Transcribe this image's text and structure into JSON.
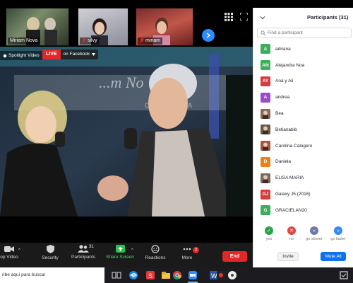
{
  "meeting": {
    "thumbnails": [
      {
        "label": "Miriam Nova",
        "muted": false
      },
      {
        "label": "silvy",
        "muted": true
      },
      {
        "label": "miriam",
        "muted": true
      }
    ],
    "spotlight_label": "Spotlight Video",
    "live": {
      "badge": "LIVE",
      "destination": "on Facebook"
    }
  },
  "toolbar": {
    "stop_video": "op Video",
    "security": "Security",
    "participants": "Participants",
    "participants_count": "31",
    "share_screen": "Share Screen",
    "reactions": "Reactions",
    "more": "More",
    "more_badge": "2",
    "end": "End"
  },
  "panel": {
    "title": "Participants (31)",
    "search_placeholder": "Find a participant",
    "participants": [
      {
        "initials": "A",
        "name": "adriana",
        "color": "#3eae5a",
        "photo": false
      },
      {
        "initials": "AN",
        "name": "Alejandra Noa",
        "color": "#3eae5a",
        "photo": false
      },
      {
        "initials": "AY",
        "name": "Ana y Ali",
        "color": "#d83b3b",
        "photo": false
      },
      {
        "initials": "A",
        "name": "andrea",
        "color": "#9b4bc9",
        "photo": false
      },
      {
        "initials": "",
        "name": "Bea",
        "color": "#8a6a58",
        "photo": true
      },
      {
        "initials": "",
        "name": "Betianabib",
        "color": "#6b5a46",
        "photo": true
      },
      {
        "initials": "",
        "name": "Carolina Calogero",
        "color": "#a8543c",
        "photo": true
      },
      {
        "initials": "D",
        "name": "Daniela",
        "color": "#ef7d1a",
        "photo": false
      },
      {
        "initials": "",
        "name": "ELISA MARIA",
        "color": "#7a6a62",
        "photo": true
      },
      {
        "initials": "GJ",
        "name": "Galaxy J5 (2016)",
        "color": "#d83b3b",
        "photo": false
      },
      {
        "initials": "G",
        "name": "GRACIELAN20",
        "color": "#3eae5a",
        "photo": false
      }
    ],
    "reactions": [
      {
        "label": "yes",
        "color": "#2aa24a",
        "symbol": "✓"
      },
      {
        "label": "no",
        "color": "#e04848",
        "symbol": "✕"
      },
      {
        "label": "go slower",
        "color": "#6b7aa8",
        "symbol": "«"
      },
      {
        "label": "go faster",
        "color": "#2d8cff",
        "symbol": "»"
      }
    ],
    "invite": "Invite",
    "mute_all": "Mute All"
  },
  "taskbar": {
    "search_text": "ribe aquí para buscar"
  }
}
